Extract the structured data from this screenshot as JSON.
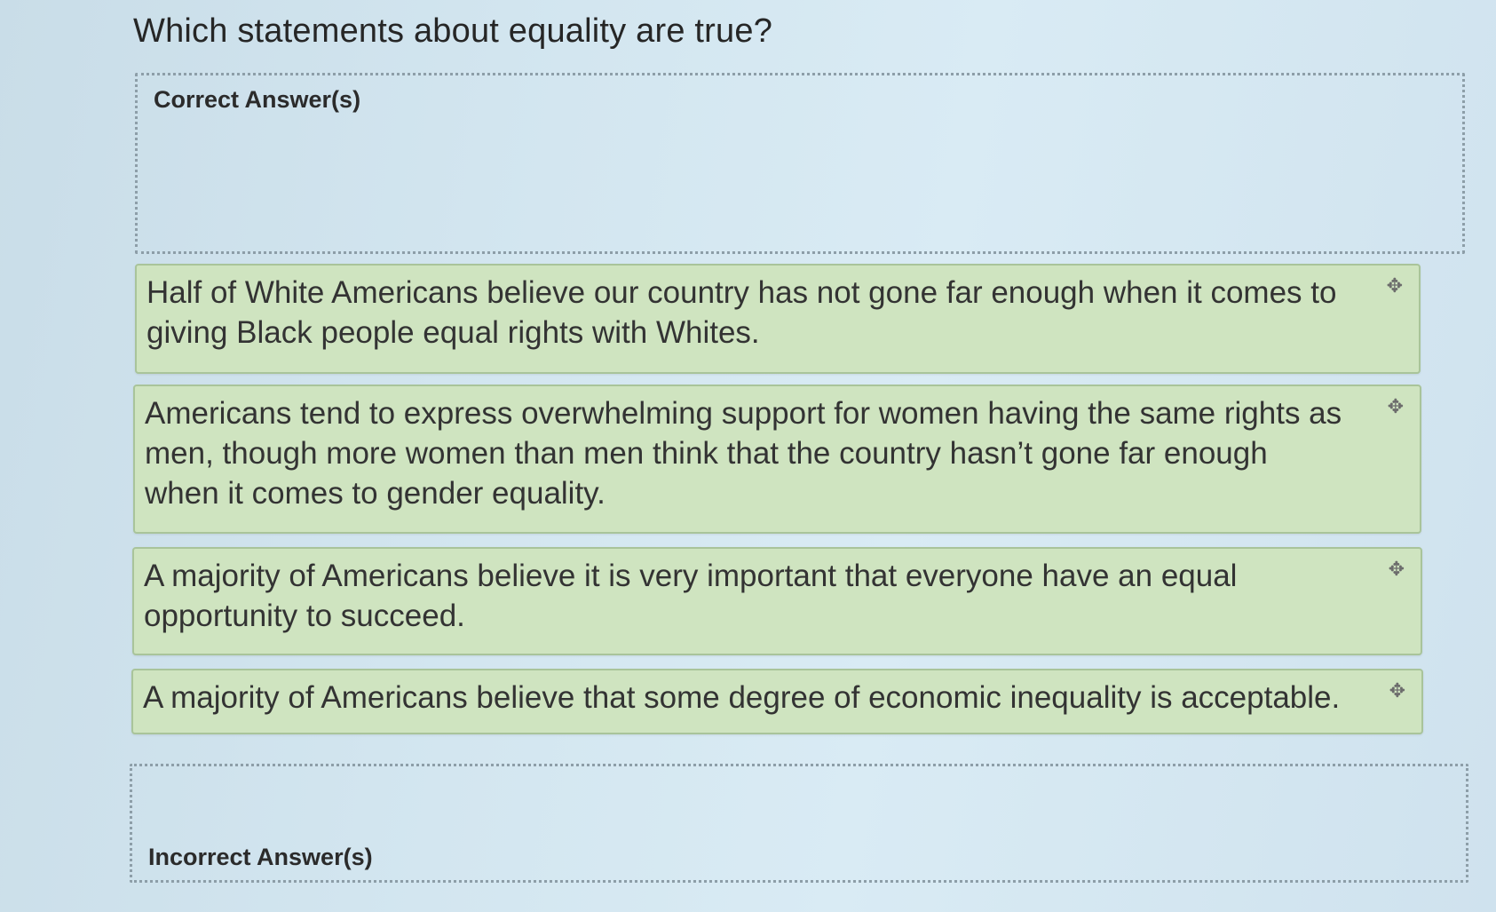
{
  "question": "Which statements about equality are true?",
  "zones": {
    "correct_label": "Correct Answer(s)",
    "incorrect_label": "Incorrect Answer(s)"
  },
  "cards": [
    {
      "text": "Half of White Americans believe our country has not gone far enough when it comes to giving Black people equal rights with Whites.",
      "icon": "drag-handle-icon"
    },
    {
      "text": "Americans tend to express overwhelming support for women having the same rights as men, though more women than men think that the country hasn’t gone far enough when it comes to gender equality.",
      "icon": "drag-handle-icon"
    },
    {
      "text": "A majority of Americans believe it is very important that everyone have an equal opportunity to succeed.",
      "icon": "drag-handle-icon"
    },
    {
      "text": "A majority of Americans believe that some degree of economic inequality is acceptable.",
      "icon": "drag-handle-icon"
    }
  ],
  "colors": {
    "card_background": "#cfe4c0",
    "card_border": "#a9c49a",
    "page_background": "#d3e6f0"
  }
}
